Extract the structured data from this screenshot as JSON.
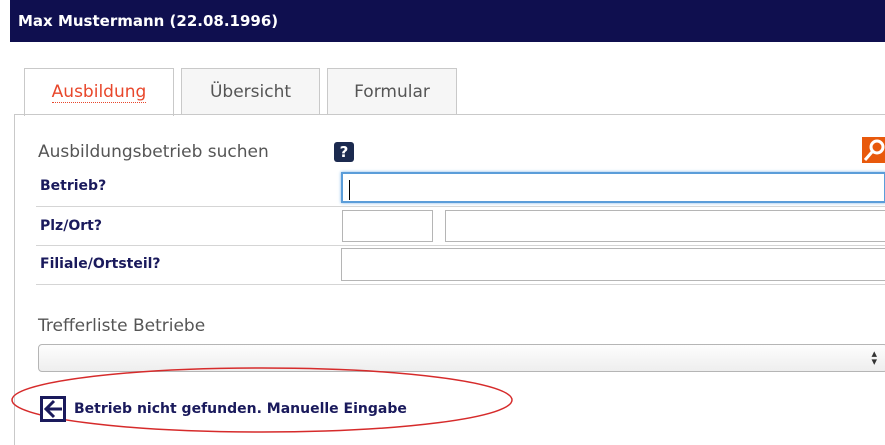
{
  "header": {
    "title": "Max Mustermann (22.08.1996)"
  },
  "tabs": [
    {
      "label": "Ausbildung",
      "active": true
    },
    {
      "label": "Übersicht",
      "active": false
    },
    {
      "label": "Formular",
      "active": false
    }
  ],
  "search_section": {
    "title": "Ausbildungsbetrieb suchen",
    "help_icon": "question-icon",
    "search_icon": "magnifier-icon",
    "fields": [
      {
        "label": "Betrieb?",
        "value": ""
      },
      {
        "label": "Plz/Ort?",
        "plz_value": "",
        "ort_value": ""
      },
      {
        "label": "Filiale/Ortsteil?",
        "value": ""
      }
    ]
  },
  "results": {
    "title": "Trefferliste Betriebe",
    "selected": ""
  },
  "manual_entry": {
    "label": "Betrieb nicht gefunden. Manuelle Eingabe",
    "icon": "back-arrow-icon"
  },
  "colors": {
    "header_bg": "#0f0f4f",
    "active_tab": "#e8472b",
    "label_color": "#1a1a5c",
    "highlight_ellipse": "#d62b2b"
  }
}
